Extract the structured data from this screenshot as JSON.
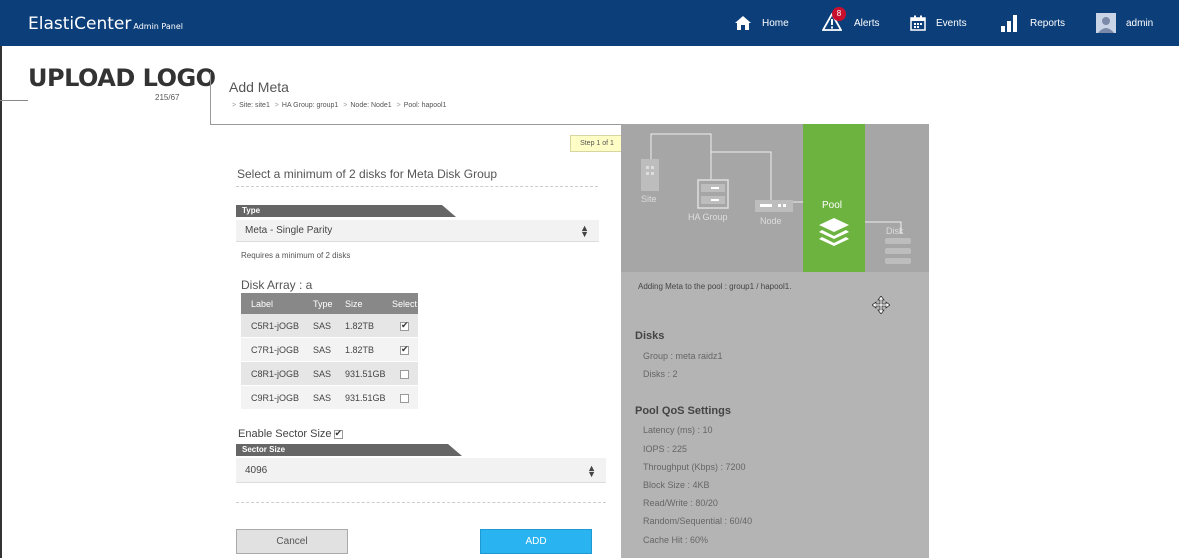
{
  "topbar": {
    "brand": "ElastiCenter",
    "brand_sub": "Admin Panel",
    "nav": [
      {
        "label": "Home",
        "icon": "home-icon"
      },
      {
        "label": "Alerts",
        "icon": "alert-icon",
        "badge": "8"
      },
      {
        "label": "Events",
        "icon": "calendar-icon"
      },
      {
        "label": "Reports",
        "icon": "bar-chart-icon"
      },
      {
        "label": "admin",
        "icon": "user-avatar-icon"
      }
    ]
  },
  "logo": {
    "text": "UPLOAD LOGO",
    "sub": "215/67"
  },
  "header": {
    "title": "Add Meta",
    "breadcrumb": [
      "Site: site1",
      "HA Group: group1",
      "Node: Node1",
      "Pool: hapool1"
    ]
  },
  "form": {
    "step": "Step 1 of 1",
    "title": "Select a minimum of 2 disks for Meta Disk Group",
    "type_label": "Type",
    "type_value": "Meta - Single Parity",
    "hint": "Requires a minimum of 2 disks",
    "disk_array_title": "Disk Array : a",
    "columns": [
      "Label",
      "Type",
      "Size",
      "Select"
    ],
    "disks": [
      {
        "label": "C5R1-jOGB",
        "type": "SAS",
        "size": "1.82TB",
        "selected": true
      },
      {
        "label": "C7R1-jOGB",
        "type": "SAS",
        "size": "1.82TB",
        "selected": true
      },
      {
        "label": "C8R1-jOGB",
        "type": "SAS",
        "size": "931.51GB",
        "selected": false
      },
      {
        "label": "C9R1-jOGB",
        "type": "SAS",
        "size": "931.51GB",
        "selected": false
      }
    ],
    "enable_sector_label": "Enable Sector Size",
    "enable_sector_checked": true,
    "sector_label": "Sector Size",
    "sector_value": "4096",
    "cancel_label": "Cancel",
    "add_label": "ADD"
  },
  "panel": {
    "diagram": {
      "site": "Site",
      "ha_group": "HA Group",
      "node": "Node",
      "pool": "Pool",
      "disk": "Disk"
    },
    "status": "Adding Meta to the pool : group1 / hapool1.",
    "disks_title": "Disks",
    "disks_items": [
      "Group : meta raidz1",
      "Disks : 2"
    ],
    "qos_title": "Pool QoS Settings",
    "qos_items": [
      "Latency (ms) : 10",
      "IOPS : 225",
      "Throughput (Kbps) : 7200",
      "Block Size : 4KB",
      "Read/Write : 80/20",
      "Random/Sequential : 60/40",
      "Cache Hit : 60%"
    ]
  },
  "colors": {
    "topbar": "#0c3f7a",
    "pool": "#6db33f",
    "add_button": "#29b3f0",
    "panel": "#b4b4b4",
    "alert_badge": "#c8102e"
  }
}
